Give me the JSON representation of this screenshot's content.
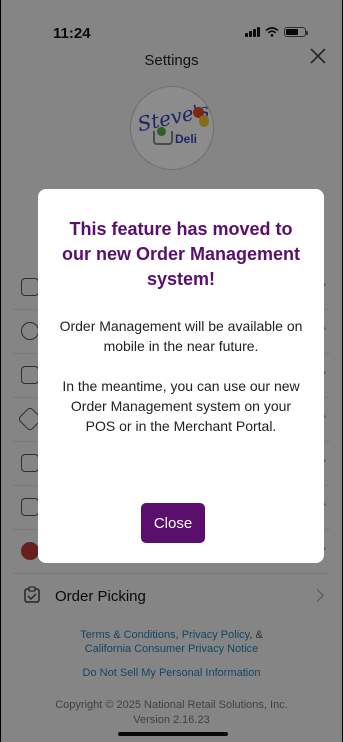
{
  "status_bar": {
    "time": "11:24"
  },
  "header": {
    "title": "Settings"
  },
  "logo": {
    "line1": "Steve's",
    "line2": "Deli"
  },
  "menu": {
    "order_picking_label": "Order Picking"
  },
  "footer": {
    "terms": "Terms & Conditions",
    "sep1": ", ",
    "privacy": "Privacy Policy",
    "sep2": ", &",
    "ca_notice": "California Consumer Privacy Notice",
    "do_not_sell": "Do Not Sell My Personal Information",
    "copyright": "Copyright © 2025 National Retail Solutions, Inc.",
    "version": "Version 2.16.23"
  },
  "modal": {
    "title": "This feature has moved to our new Order Management system!",
    "body1": "Order Management will be available on mobile in the near future.",
    "body2": "In the meantime, you can use our new Order Management system on your POS or in the Merchant Portal.",
    "button": "Close"
  },
  "colors": {
    "brand_purple": "#5a0f6e",
    "link_blue": "#1f7fb6"
  }
}
